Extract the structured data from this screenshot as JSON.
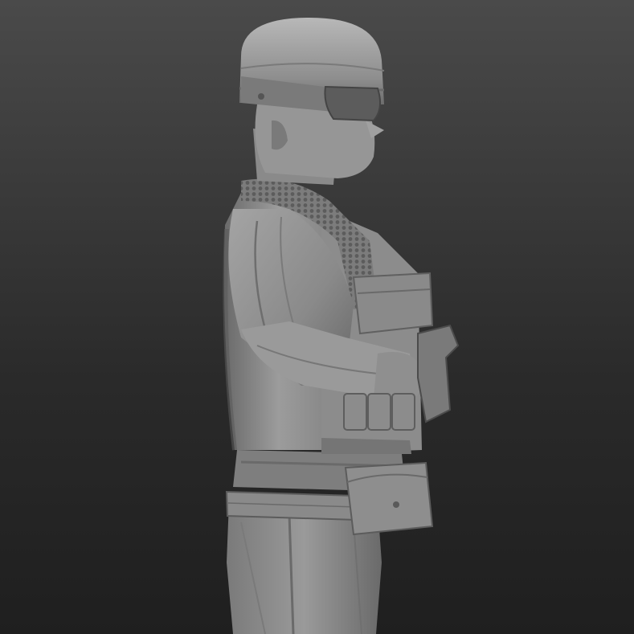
{
  "scene": {
    "subject": "soldier-sculpt",
    "material_colors": {
      "base": "#8e8e8e",
      "light": "#b4b4b4",
      "shadow": "#5a5a5a",
      "deep_shadow": "#444444"
    },
    "background_colors": {
      "top": "#4a4a4a",
      "bottom": "#1f1f1f"
    }
  }
}
